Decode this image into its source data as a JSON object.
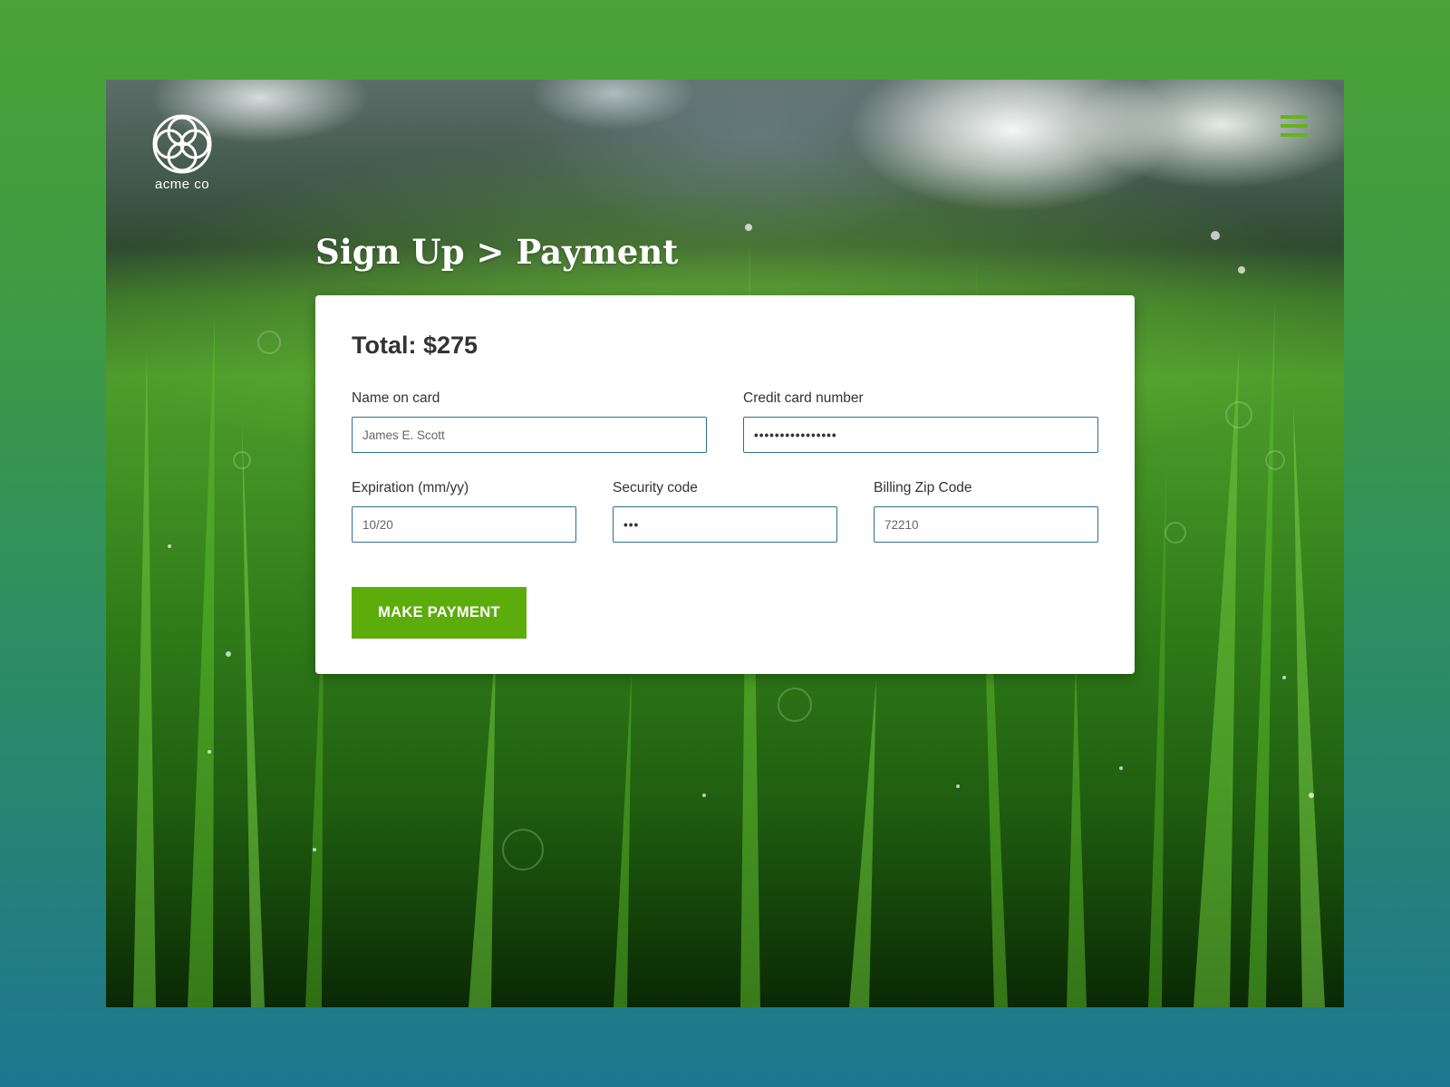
{
  "brand": {
    "name": "acme co",
    "logo_icon": "interlocking-circles-logo"
  },
  "header": {
    "menu_icon": "hamburger-menu-icon",
    "menu_color": "#64b41c"
  },
  "page": {
    "title": "Sign Up > Payment"
  },
  "payment": {
    "total_label": "Total: $275",
    "fields": {
      "name_on_card": {
        "label": "Name on card",
        "value": "James E. Scott"
      },
      "credit_card_number": {
        "label": "Credit card number",
        "value": "••••••••••••••••"
      },
      "expiration": {
        "label": "Expiration (mm/yy)",
        "value": "10/20"
      },
      "security_code": {
        "label": "Security code",
        "value": "•••"
      },
      "billing_zip": {
        "label": "Billing Zip Code",
        "value": "72210"
      }
    },
    "submit_label": "MAKE PAYMENT"
  },
  "colors": {
    "accent": "#5cac0c",
    "input_border": "#2f6e8e",
    "text": "#333333"
  }
}
